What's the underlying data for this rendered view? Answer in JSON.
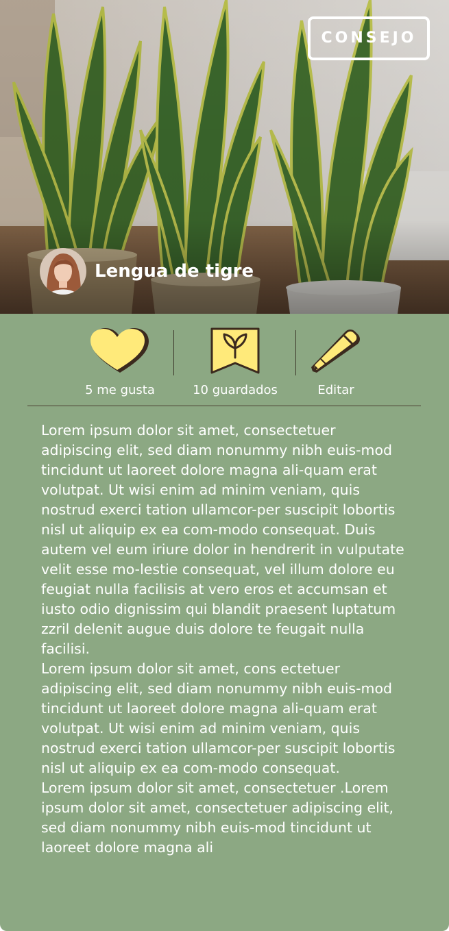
{
  "tag": "CONSEJO",
  "plant_name": "Lengua de tigre",
  "actions": {
    "likes": "5 me gusta",
    "saves": "10 guardados",
    "edit": "Editar"
  },
  "paragraphs": [
    "Lorem ipsum dolor sit amet, consectetuer adipiscing elit, sed diam nonummy nibh euis-mod tincidunt ut laoreet dolore magna ali-quam erat volutpat. Ut wisi enim ad minim veniam, quis nostrud exerci tation ullamcor-per suscipit lobortis nisl ut aliquip ex ea com-modo consequat. Duis autem vel eum iriure dolor in hendrerit in vulputate velit esse mo-lestie consequat, vel illum dolore eu feugiat nulla facilisis at vero eros et accumsan et iusto odio dignissim qui blandit praesent luptatum zzril delenit augue duis dolore te feugait nulla facilisi.",
    "Lorem ipsum dolor sit amet, cons ectetuer adipiscing elit, sed diam nonummy nibh euis-mod tincidunt ut laoreet dolore magna ali-quam erat volutpat. Ut wisi enim ad minim veniam, quis nostrud exerci tation ullamcor-per suscipit lobortis nisl ut aliquip ex ea com-modo consequat.",
    "Lorem ipsum dolor sit amet, consectetuer .Lorem ipsum dolor sit amet, consectetuer adipiscing elit, sed diam nonummy nibh euis-mod tincidunt ut laoreet dolore magna ali"
  ],
  "icons": {
    "like": "heart-icon",
    "save": "bookmark-leaf-icon",
    "edit": "pencil-icon"
  },
  "colors": {
    "card_background": "#8ca883",
    "icon_fill": "#ffea7a",
    "icon_stroke": "#3b2a1e"
  }
}
